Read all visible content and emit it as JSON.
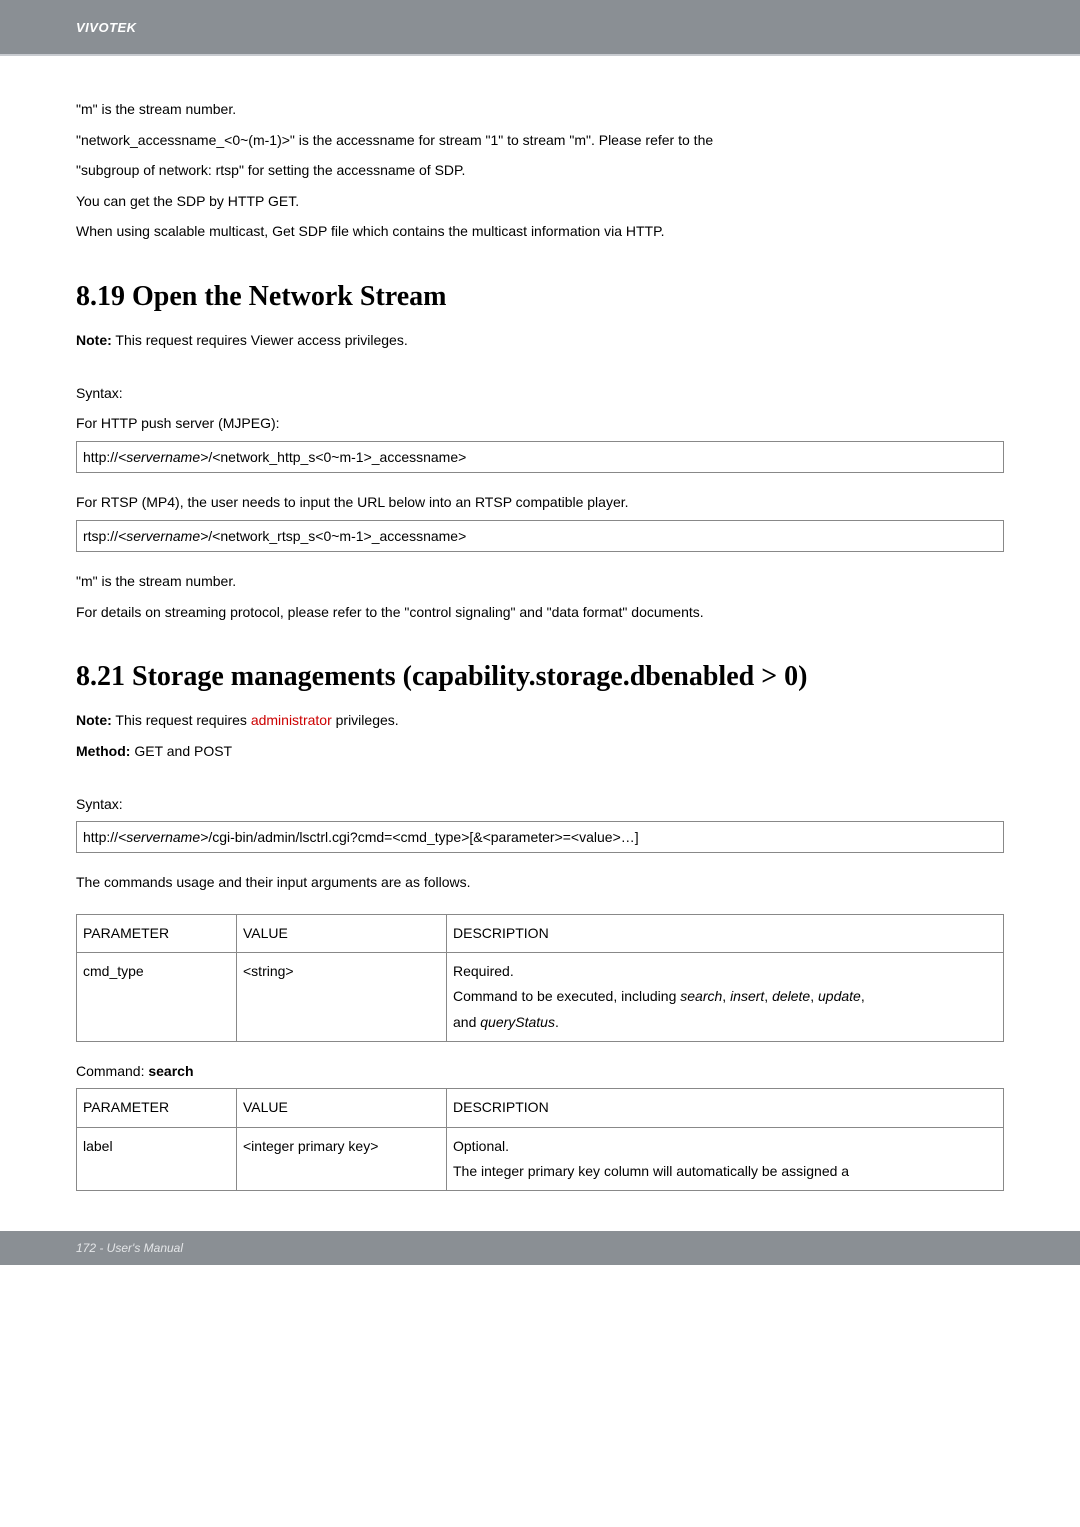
{
  "brand": "VIVOTEK",
  "intro": {
    "p1": "\"m\" is the stream number.",
    "p2": "\"network_accessname_<0~(m-1)>\" is the accessname for stream \"1\" to stream \"m\". Please refer to the",
    "p3": "\"subgroup of network: rtsp\" for setting the accessname of SDP.",
    "p4": "You can get the SDP by HTTP GET.",
    "p5": "When using scalable multicast, Get SDP file which contains the multicast information via HTTP."
  },
  "s819": {
    "heading": "8.19 Open the Network Stream",
    "note_label": "Note:",
    "note_text": " This request requires Viewer access privileges.",
    "syntax_label": "Syntax:",
    "mjpeg_line": "For HTTP push server (MJPEG):",
    "mjpeg_url_prefix": "http://",
    "mjpeg_url_server": "<servername>",
    "mjpeg_url_rest": "/<network_http_s<0~m-1>_accessname>",
    "rtsp_line": "For RTSP (MP4), the user needs to input the URL below into an RTSP compatible player.",
    "rtsp_url_prefix": "rtsp://",
    "rtsp_url_server": "<servername>",
    "rtsp_url_rest": "/<network_rtsp_s<0~m-1>_accessname>",
    "m_line": "\"m\" is the stream number.",
    "details_line": "For details on streaming protocol, please refer to the \"control signaling\" and \"data format\" documents."
  },
  "s821": {
    "heading": "8.21 Storage managements (capability.storage.dbenabled > 0)",
    "note_label": "Note:",
    "note_text_pre": " This request requires ",
    "note_text_admin": "administrator",
    "note_text_post": " privileges.",
    "method_label": "Method:",
    "method_text": " GET and POST",
    "syntax_label": "Syntax:",
    "url_prefix": "http://",
    "url_server": "<servername>",
    "url_rest": "/cgi-bin/admin/lsctrl.cgi?cmd=<cmd_type>[&<parameter>=<value>…]",
    "usage_line": "The commands usage and their input arguments are as follows.",
    "table1": {
      "h_param": "PARAMETER",
      "h_value": "VALUE",
      "h_desc": "DESCRIPTION",
      "r1_param": "cmd_type",
      "r1_value": "<string>",
      "r1_desc_l1": "Required.",
      "r1_desc_l2a": "Command to be executed, including ",
      "r1_desc_l2_search": "search",
      "r1_desc_l2_c1": ", ",
      "r1_desc_l2_insert": "insert",
      "r1_desc_l2_c2": ", ",
      "r1_desc_l2_delete": "delete",
      "r1_desc_l2_c3": ", ",
      "r1_desc_l2_update": "update",
      "r1_desc_l2_c4": ",",
      "r1_desc_l3a": "and ",
      "r1_desc_l3_qs": "queryStatus",
      "r1_desc_l3b": "."
    },
    "cmd_label_pre": "Command: ",
    "cmd_label_bold": "search",
    "table2": {
      "h_param": "PARAMETER",
      "h_value": "VALUE",
      "h_desc": "DESCRIPTION",
      "r1_param": "label",
      "r1_value": "<integer primary key>",
      "r1_desc_l1": "Optional.",
      "r1_desc_l2": "The integer primary key column will automatically be assigned a"
    }
  },
  "footer": "172 - User's Manual"
}
